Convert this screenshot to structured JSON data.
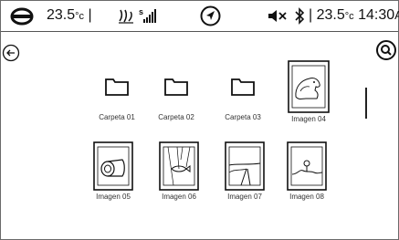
{
  "status_bar": {
    "temp_left": "23.5",
    "temp_left_unit": "°c",
    "temp_right": "23.5",
    "temp_right_unit": "°c",
    "time": "14:30",
    "time_suffix": "A",
    "icons": [
      "brand-logo-icon",
      "fan-icon",
      "signal-icon",
      "navigation-icon",
      "mute-icon",
      "bluetooth-icon"
    ]
  },
  "items": [
    {
      "label": "Carpeta 01",
      "type": "folder"
    },
    {
      "label": "Carpeta 02",
      "type": "folder"
    },
    {
      "label": "Carpeta 03",
      "type": "folder"
    },
    {
      "label": "Imagen 04",
      "type": "image",
      "icon": "image-creature-icon"
    },
    {
      "label": "Imagen 05",
      "type": "image",
      "icon": "image-device-icon"
    },
    {
      "label": "Imagen 06",
      "type": "image",
      "icon": "image-fish-icon"
    },
    {
      "label": "Imagen 07",
      "type": "image",
      "icon": "image-road-icon"
    },
    {
      "label": "Imagen 08",
      "type": "image",
      "icon": "image-landscape-icon"
    }
  ]
}
